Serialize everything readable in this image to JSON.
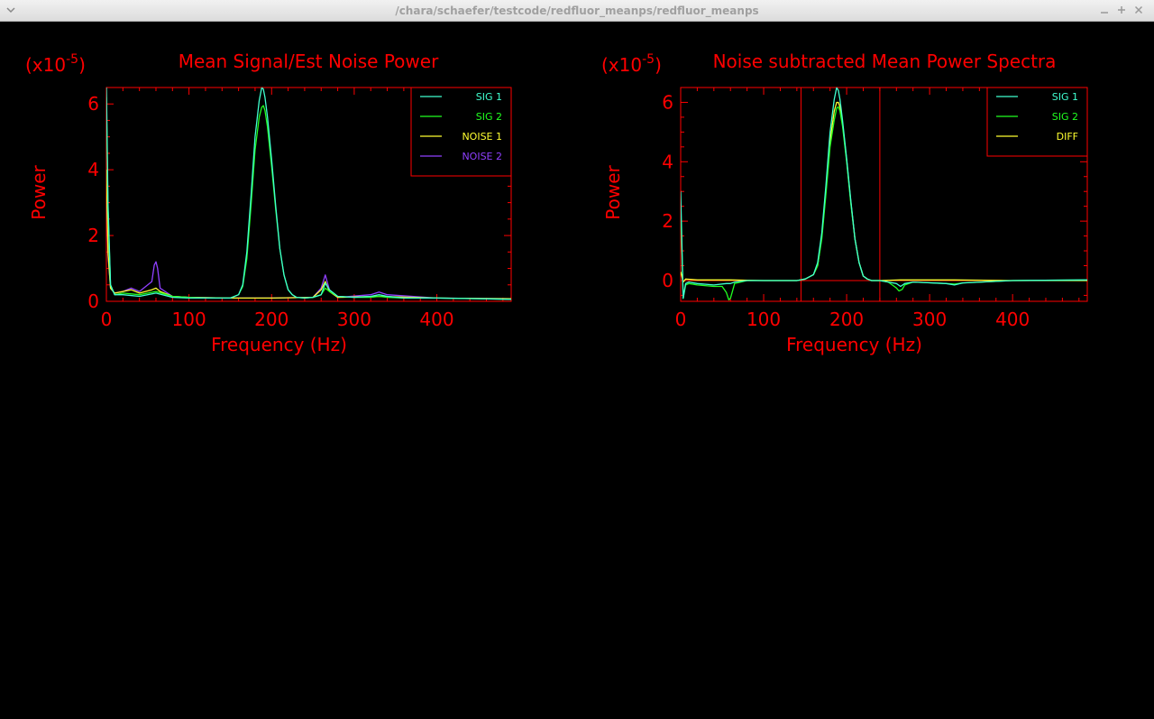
{
  "window": {
    "title": "/chara/schaefer/testcode/redfluor_meanps/redfluor_meanps",
    "menu_icon": "chevron-down-icon",
    "controls": [
      "minimize-icon",
      "maximize-icon",
      "close-icon"
    ]
  },
  "colors": {
    "axes": "#ff0000",
    "sig1": "#40ffd0",
    "sig2": "#20ff20",
    "noise1": "#ffff30",
    "noise2": "#9040ff",
    "diff": "#ffff30",
    "background": "#000000"
  },
  "chart_data": [
    {
      "type": "line",
      "title": "Mean Signal/Est Noise Power",
      "multiplier": "(x10",
      "multiplier_exp": "-5",
      "multiplier_close": ")",
      "xlabel": "Frequency (Hz)",
      "ylabel": "Power",
      "xlim": [
        0,
        490
      ],
      "ylim": [
        0,
        6.5
      ],
      "xticks": [
        0,
        100,
        200,
        300,
        400
      ],
      "yticks": [
        0,
        2,
        4,
        6
      ],
      "legend_position": "top-right",
      "series": [
        {
          "name": "SIG 1",
          "color": "#40ffd0",
          "x": [
            0,
            2,
            5,
            10,
            20,
            40,
            60,
            80,
            100,
            120,
            140,
            150,
            160,
            165,
            170,
            175,
            180,
            185,
            188,
            190,
            192,
            195,
            200,
            205,
            210,
            215,
            220,
            225,
            230,
            240,
            250,
            260,
            265,
            270,
            280,
            300,
            320,
            330,
            340,
            360,
            400,
            450,
            490
          ],
          "y": [
            6.5,
            3.0,
            0.5,
            0.2,
            0.2,
            0.15,
            0.25,
            0.12,
            0.1,
            0.1,
            0.1,
            0.1,
            0.2,
            0.5,
            1.5,
            3.2,
            5.0,
            6.1,
            6.5,
            6.45,
            6.2,
            5.6,
            4.3,
            2.9,
            1.6,
            0.8,
            0.35,
            0.2,
            0.12,
            0.1,
            0.12,
            0.2,
            0.55,
            0.35,
            0.15,
            0.12,
            0.15,
            0.2,
            0.15,
            0.1,
            0.1,
            0.08,
            0.06
          ]
        },
        {
          "name": "SIG 2",
          "color": "#20ff20",
          "x": [
            0,
            2,
            5,
            10,
            20,
            40,
            60,
            80,
            100,
            120,
            140,
            150,
            160,
            165,
            170,
            175,
            180,
            185,
            188,
            190,
            192,
            195,
            200,
            205,
            210,
            215,
            220,
            225,
            230,
            240,
            250,
            260,
            265,
            270,
            280,
            300,
            320,
            330,
            340,
            360,
            400,
            450,
            490
          ],
          "y": [
            6.2,
            2.8,
            0.5,
            0.2,
            0.25,
            0.2,
            0.3,
            0.15,
            0.12,
            0.1,
            0.1,
            0.1,
            0.2,
            0.45,
            1.3,
            2.9,
            4.6,
            5.6,
            5.9,
            5.95,
            5.8,
            5.3,
            4.1,
            2.8,
            1.6,
            0.8,
            0.35,
            0.2,
            0.12,
            0.1,
            0.12,
            0.2,
            0.4,
            0.3,
            0.15,
            0.12,
            0.12,
            0.15,
            0.12,
            0.1,
            0.1,
            0.08,
            0.06
          ]
        },
        {
          "name": "NOISE 1",
          "color": "#ffff30",
          "x": [
            0,
            2,
            5,
            10,
            20,
            30,
            40,
            55,
            60,
            65,
            80,
            100,
            150,
            200,
            250,
            260,
            265,
            270,
            280,
            330,
            400,
            490
          ],
          "y": [
            4.0,
            1.5,
            0.4,
            0.25,
            0.3,
            0.35,
            0.25,
            0.35,
            0.4,
            0.3,
            0.15,
            0.12,
            0.1,
            0.1,
            0.12,
            0.35,
            0.6,
            0.3,
            0.12,
            0.15,
            0.1,
            0.08
          ]
        },
        {
          "name": "NOISE 2",
          "color": "#9040ff",
          "x": [
            0,
            2,
            5,
            10,
            20,
            30,
            40,
            55,
            58,
            60,
            62,
            65,
            80,
            100,
            150,
            200,
            250,
            260,
            265,
            270,
            280,
            320,
            330,
            340,
            400,
            490
          ],
          "y": [
            3.8,
            1.4,
            0.4,
            0.25,
            0.3,
            0.4,
            0.3,
            0.6,
            1.1,
            1.2,
            1.0,
            0.4,
            0.15,
            0.12,
            0.1,
            0.1,
            0.12,
            0.4,
            0.8,
            0.35,
            0.12,
            0.2,
            0.28,
            0.2,
            0.1,
            0.08
          ]
        }
      ]
    },
    {
      "type": "line",
      "title": "Noise subtracted Mean Power Spectra",
      "multiplier": "(x10",
      "multiplier_exp": "-5",
      "multiplier_close": ")",
      "xlabel": "Frequency (Hz)",
      "ylabel": "Power",
      "xlim": [
        0,
        490
      ],
      "ylim": [
        -0.7,
        6.5
      ],
      "xticks": [
        0,
        100,
        200,
        300,
        400
      ],
      "yticks": [
        0,
        2,
        4,
        6
      ],
      "legend_position": "top-right",
      "vlines": [
        145,
        240
      ],
      "hline": 0,
      "series": [
        {
          "name": "SIG 1",
          "color": "#40ffd0",
          "x": [
            0,
            3,
            6,
            10,
            20,
            40,
            55,
            60,
            65,
            80,
            100,
            140,
            150,
            160,
            165,
            170,
            175,
            180,
            185,
            188,
            190,
            192,
            195,
            200,
            205,
            210,
            215,
            220,
            225,
            230,
            240,
            250,
            260,
            265,
            270,
            280,
            320,
            330,
            340,
            400,
            490
          ],
          "y": [
            3.0,
            -0.6,
            -0.1,
            -0.05,
            -0.1,
            -0.15,
            -0.1,
            -0.1,
            -0.05,
            0,
            0,
            0,
            0.05,
            0.2,
            0.6,
            1.6,
            3.2,
            5.0,
            6.1,
            6.5,
            6.4,
            6.1,
            5.4,
            4.1,
            2.7,
            1.4,
            0.6,
            0.15,
            0.05,
            0,
            0,
            -0.05,
            -0.1,
            -0.2,
            -0.1,
            -0.05,
            -0.1,
            -0.15,
            -0.08,
            0,
            0.02
          ]
        },
        {
          "name": "SIG 2",
          "color": "#20ff20",
          "x": [
            0,
            3,
            6,
            10,
            20,
            40,
            50,
            55,
            58,
            60,
            62,
            65,
            80,
            100,
            140,
            150,
            160,
            165,
            170,
            175,
            180,
            185,
            188,
            190,
            192,
            195,
            200,
            205,
            210,
            215,
            220,
            225,
            230,
            240,
            250,
            255,
            260,
            263,
            267,
            270,
            280,
            320,
            330,
            340,
            400,
            490
          ],
          "y": [
            2.5,
            -0.6,
            -0.15,
            -0.1,
            -0.15,
            -0.2,
            -0.2,
            -0.4,
            -0.65,
            -0.6,
            -0.4,
            -0.1,
            0,
            0,
            0,
            0.05,
            0.2,
            0.5,
            1.4,
            2.9,
            4.5,
            5.4,
            5.8,
            5.85,
            5.7,
            5.2,
            4.0,
            2.6,
            1.4,
            0.6,
            0.15,
            0.05,
            0,
            0,
            -0.05,
            -0.15,
            -0.25,
            -0.35,
            -0.3,
            -0.15,
            -0.05,
            -0.1,
            -0.12,
            -0.08,
            0,
            0.02
          ]
        },
        {
          "name": "DIFF",
          "color": "#ffff30",
          "x": [
            0,
            3,
            6,
            20,
            60,
            100,
            140,
            150,
            160,
            165,
            170,
            175,
            180,
            185,
            188,
            190,
            192,
            195,
            200,
            205,
            210,
            215,
            220,
            225,
            230,
            240,
            265,
            330,
            400,
            490
          ],
          "y": [
            0.3,
            -0.05,
            0.05,
            0.02,
            0.02,
            0,
            0,
            0.05,
            0.2,
            0.5,
            1.5,
            3.0,
            4.7,
            5.7,
            6.0,
            6.0,
            5.85,
            5.3,
            4.05,
            2.65,
            1.4,
            0.6,
            0.15,
            0.05,
            0,
            0,
            0.02,
            0.02,
            0,
            0
          ]
        }
      ]
    }
  ]
}
